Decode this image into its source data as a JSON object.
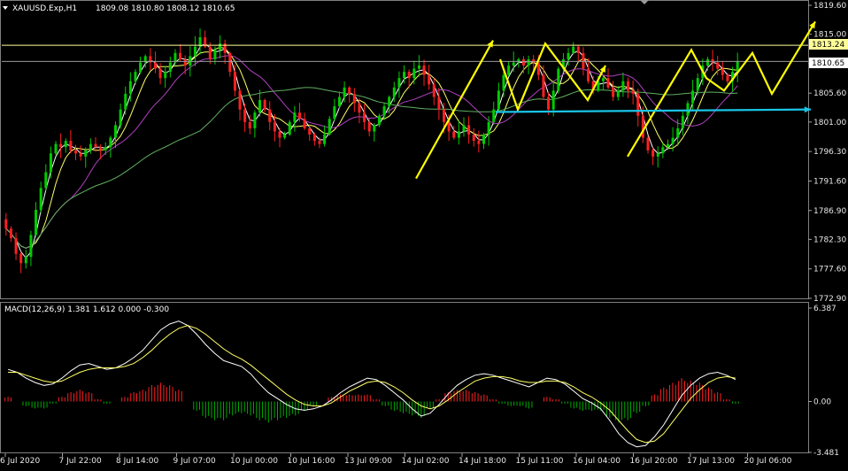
{
  "header": {
    "symbol_label": "XAUUSD.Exp,H1",
    "ohlc_values": "1809.08 1810.80 1808.12 1810.65"
  },
  "price_tags": {
    "line_1813_label": "1813.24",
    "line_1810_label": "1810.65"
  },
  "macd_header": {
    "label": "MACD(12,26,9) 1.381 1.612 0.000 -0.300"
  },
  "colors": {
    "background": "#000000",
    "bull_candle": "#00cc00",
    "bear_candle": "#ff2020",
    "ma_fast": "#ffffff",
    "ma_yellow": "#ffff66",
    "ma_purple": "#b040c0",
    "ma_green": "#60b060",
    "h_line": "#ffff99",
    "drawn_arrows": "#ffff00",
    "support_arrow": "#19c5e6",
    "macd_pos": "#ff2020",
    "macd_neg": "#00aa00",
    "macd_line": "#ffffff",
    "signal_line": "#ffff66",
    "grid_text": "#e8e8e8"
  },
  "chart_data": [
    {
      "type": "candlestick",
      "title": "XAUUSD.Exp,H1",
      "ylim": [
        1772.9,
        1819.6
      ],
      "y_ticks": [
        "1819.60",
        "1815.00",
        "1810.35",
        "1805.60",
        "1801.00",
        "1796.30",
        "1791.60",
        "1786.90",
        "1782.30",
        "1777.60",
        "1772.90"
      ],
      "x_ticks": [
        "6 Jul 2020",
        "7 Jul 22:00",
        "8 Jul 14:00",
        "9 Jul 07:00",
        "10 Jul 00:00",
        "10 Jul 16:00",
        "13 Jul 09:00",
        "14 Jul 02:00",
        "14 Jul 18:00",
        "15 Jul 11:00",
        "16 Jul 04:00",
        "16 Jul 20:00",
        "17 Jul 13:00",
        "20 Jul 06:00"
      ],
      "horizontal_lines": [
        1813.24,
        1810.65
      ],
      "close": [
        1784.0,
        1782.5,
        1780.0,
        1778.5,
        1779.5,
        1783.0,
        1787.0,
        1790.5,
        1793.0,
        1796.0,
        1797.5,
        1797.0,
        1798.0,
        1796.5,
        1796.0,
        1795.5,
        1796.5,
        1797.5,
        1797.0,
        1796.5,
        1797.0,
        1798.5,
        1800.5,
        1803.0,
        1805.5,
        1807.5,
        1809.0,
        1810.5,
        1811.5,
        1810.5,
        1809.5,
        1808.0,
        1809.0,
        1810.5,
        1812.0,
        1811.0,
        1810.0,
        1811.5,
        1813.0,
        1814.5,
        1813.0,
        1811.0,
        1812.5,
        1813.5,
        1812.0,
        1809.0,
        1806.0,
        1803.0,
        1801.0,
        1800.0,
        1802.5,
        1804.5,
        1803.0,
        1801.0,
        1799.5,
        1798.5,
        1799.0,
        1801.0,
        1802.5,
        1801.5,
        1800.0,
        1799.0,
        1798.0,
        1797.5,
        1799.0,
        1801.5,
        1803.5,
        1805.0,
        1806.5,
        1805.5,
        1804.0,
        1802.5,
        1801.0,
        1799.5,
        1800.5,
        1802.0,
        1803.5,
        1805.0,
        1806.5,
        1808.0,
        1809.0,
        1808.0,
        1809.5,
        1810.0,
        1808.5,
        1807.0,
        1805.0,
        1803.0,
        1801.0,
        1799.5,
        1798.5,
        1799.5,
        1800.5,
        1799.0,
        1798.0,
        1797.5,
        1799.0,
        1801.0,
        1803.0,
        1806.0,
        1808.5,
        1810.0,
        1810.5,
        1811.0,
        1810.0,
        1811.0,
        1810.5,
        1808.5,
        1805.0,
        1803.0,
        1806.0,
        1809.5,
        1811.0,
        1812.0,
        1813.0,
        1812.0,
        1809.5,
        1807.5,
        1806.0,
        1807.5,
        1808.0,
        1806.5,
        1805.0,
        1806.0,
        1807.5,
        1806.0,
        1805.5,
        1802.0,
        1798.5,
        1796.5,
        1795.5,
        1796.0,
        1797.0,
        1797.5,
        1798.5,
        1800.0,
        1802.0,
        1804.0,
        1806.0,
        1808.0,
        1810.0,
        1811.0,
        1810.5,
        1809.5,
        1808.5,
        1807.5,
        1809.0,
        1810.65
      ],
      "projection_path": [
        [
          150,
          1809.5
        ],
        [
          153,
          1811.8
        ],
        [
          156,
          1806.0
        ],
        [
          161,
          1815.0
        ]
      ]
    },
    {
      "type": "line",
      "title": "MACD(12,26,9) 1.381 1.612 0.000 -0.300",
      "ylim": [
        -3.481,
        6.387
      ],
      "y_ticks": [
        "6.387",
        "0.00",
        "-3.481"
      ],
      "series": [
        {
          "name": "MACD",
          "values": [
            2.2,
            2.0,
            1.6,
            1.3,
            1.1,
            1.2,
            1.6,
            2.1,
            2.5,
            2.6,
            2.4,
            2.2,
            2.3,
            2.6,
            3.0,
            3.5,
            4.2,
            4.9,
            5.3,
            5.5,
            5.2,
            4.6,
            3.9,
            3.3,
            2.8,
            2.6,
            2.4,
            1.9,
            1.2,
            0.6,
            0.2,
            -0.2,
            -0.5,
            -0.6,
            -0.5,
            -0.3,
            0.1,
            0.6,
            1.0,
            1.3,
            1.6,
            1.5,
            1.1,
            0.6,
            0.1,
            -0.5,
            -1.0,
            -0.8,
            -0.2,
            0.5,
            1.1,
            1.5,
            1.8,
            1.9,
            1.8,
            1.6,
            1.4,
            1.2,
            1.0,
            1.3,
            1.6,
            1.5,
            1.2,
            0.7,
            0.2,
            -0.1,
            -0.5,
            -1.3,
            -2.2,
            -2.8,
            -3.1,
            -3.0,
            -2.4,
            -1.6,
            -0.6,
            0.4,
            1.1,
            1.6,
            1.9,
            2.0,
            1.8,
            1.5
          ]
        },
        {
          "name": "Signal",
          "values": [
            2.0,
            2.0,
            1.8,
            1.6,
            1.4,
            1.3,
            1.4,
            1.7,
            2.0,
            2.2,
            2.3,
            2.3,
            2.3,
            2.4,
            2.6,
            3.0,
            3.5,
            4.1,
            4.6,
            5.0,
            5.2,
            5.0,
            4.6,
            4.1,
            3.6,
            3.2,
            2.9,
            2.5,
            2.0,
            1.5,
            1.0,
            0.5,
            0.1,
            -0.2,
            -0.3,
            -0.3,
            -0.1,
            0.3,
            0.7,
            1.0,
            1.3,
            1.4,
            1.3,
            1.0,
            0.6,
            0.1,
            -0.3,
            -0.5,
            -0.3,
            0.1,
            0.6,
            1.0,
            1.4,
            1.6,
            1.7,
            1.7,
            1.6,
            1.4,
            1.3,
            1.3,
            1.4,
            1.4,
            1.3,
            1.0,
            0.6,
            0.3,
            -0.1,
            -0.6,
            -1.3,
            -2.0,
            -2.6,
            -2.8,
            -2.7,
            -2.2,
            -1.4,
            -0.6,
            0.2,
            0.8,
            1.3,
            1.6,
            1.7,
            1.6
          ]
        },
        {
          "name": "Histogram",
          "values": [
            0.2,
            0.0,
            -0.2,
            -0.3,
            -0.3,
            -0.1,
            0.2,
            0.4,
            0.5,
            0.4,
            0.1,
            -0.1,
            0.0,
            0.2,
            0.4,
            0.5,
            0.7,
            0.8,
            0.7,
            0.5,
            0.0,
            -0.4,
            -0.7,
            -0.8,
            -0.8,
            -0.6,
            -0.5,
            -0.6,
            -0.8,
            -0.9,
            -0.8,
            -0.7,
            -0.6,
            -0.4,
            -0.2,
            0.0,
            0.2,
            0.3,
            0.3,
            0.3,
            0.3,
            0.1,
            -0.2,
            -0.4,
            -0.5,
            -0.6,
            -0.7,
            -0.3,
            0.1,
            0.4,
            0.5,
            0.5,
            0.4,
            0.3,
            0.1,
            -0.1,
            -0.2,
            -0.2,
            -0.3,
            0.0,
            0.2,
            0.1,
            -0.1,
            -0.3,
            -0.4,
            -0.4,
            -0.4,
            -0.7,
            -0.9,
            -0.8,
            -0.5,
            -0.2,
            0.3,
            0.6,
            0.8,
            1.0,
            0.9,
            0.8,
            0.6,
            0.4,
            0.1,
            -0.1
          ]
        }
      ]
    }
  ]
}
